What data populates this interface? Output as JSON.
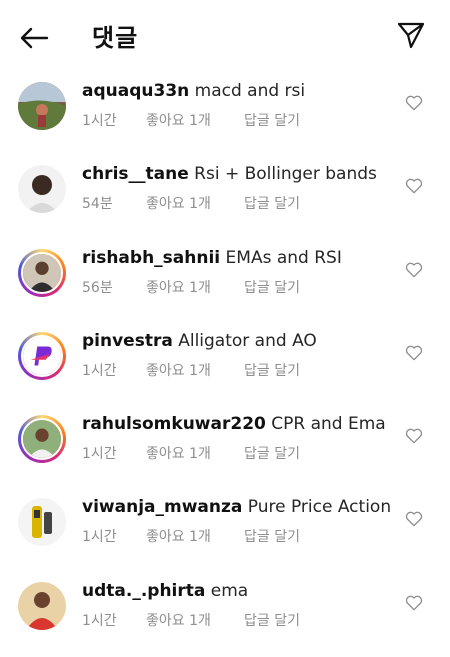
{
  "header": {
    "title": "댓글",
    "back_icon": "arrow-left-icon",
    "send_icon": "send-icon"
  },
  "comments": [
    {
      "username": "aquaqu33n",
      "text": "macd and rsi",
      "time": "1시간",
      "likes": "좋아요 1개",
      "reply": "답글 달기"
    },
    {
      "username": "chris__tane",
      "text": "Rsi + Bollinger bands",
      "time": "54분",
      "likes": "좋아요 1개",
      "reply": "답글 달기"
    },
    {
      "username": "rishabh_sahnii",
      "text": "EMAs and RSI",
      "time": "56분",
      "likes": "좋아요 1개",
      "reply": "답글 달기"
    },
    {
      "username": "pinvestra",
      "text": "Alligator and AO",
      "time": "1시간",
      "likes": "좋아요 1개",
      "reply": "답글 달기"
    },
    {
      "username": "rahulsomkuwar220",
      "text": "CPR and Ema",
      "time": "1시간",
      "likes": "좋아요 1개",
      "reply": "답글 달기"
    },
    {
      "username": "viwanja_mwanza",
      "text": "Pure Price Action",
      "time": "1시간",
      "likes": "좋아요 1개",
      "reply": "답글 달기"
    },
    {
      "username": "udta._.phirta",
      "text": "ema",
      "time": "1시간",
      "likes": "좋아요 1개",
      "reply": "답글 달기"
    }
  ]
}
